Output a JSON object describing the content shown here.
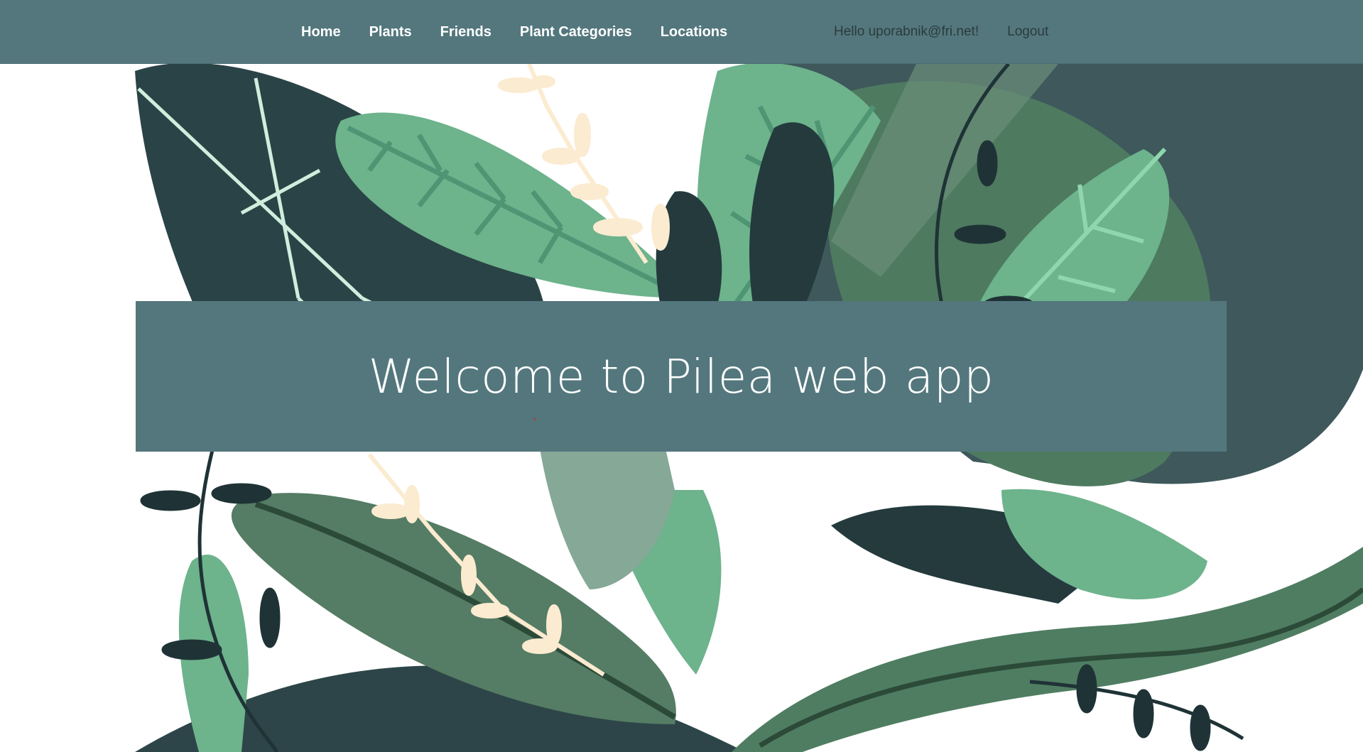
{
  "nav": {
    "links": [
      "Home",
      "Plants",
      "Friends",
      "Plant Categories",
      "Locations"
    ],
    "greeting": "Hello uporabnik@fri.net!",
    "logout_label": "Logout"
  },
  "hero": {
    "title": "Welcome to Pilea web app",
    "illustration_icon": "leaves-illustration"
  },
  "colors": {
    "navbar": "#53777d",
    "banner": "#53777d",
    "leaf_dark": "#243a3d",
    "leaf_mid": "#4f7d62",
    "leaf_light": "#6db38c",
    "sprig": "#fbebd0"
  }
}
